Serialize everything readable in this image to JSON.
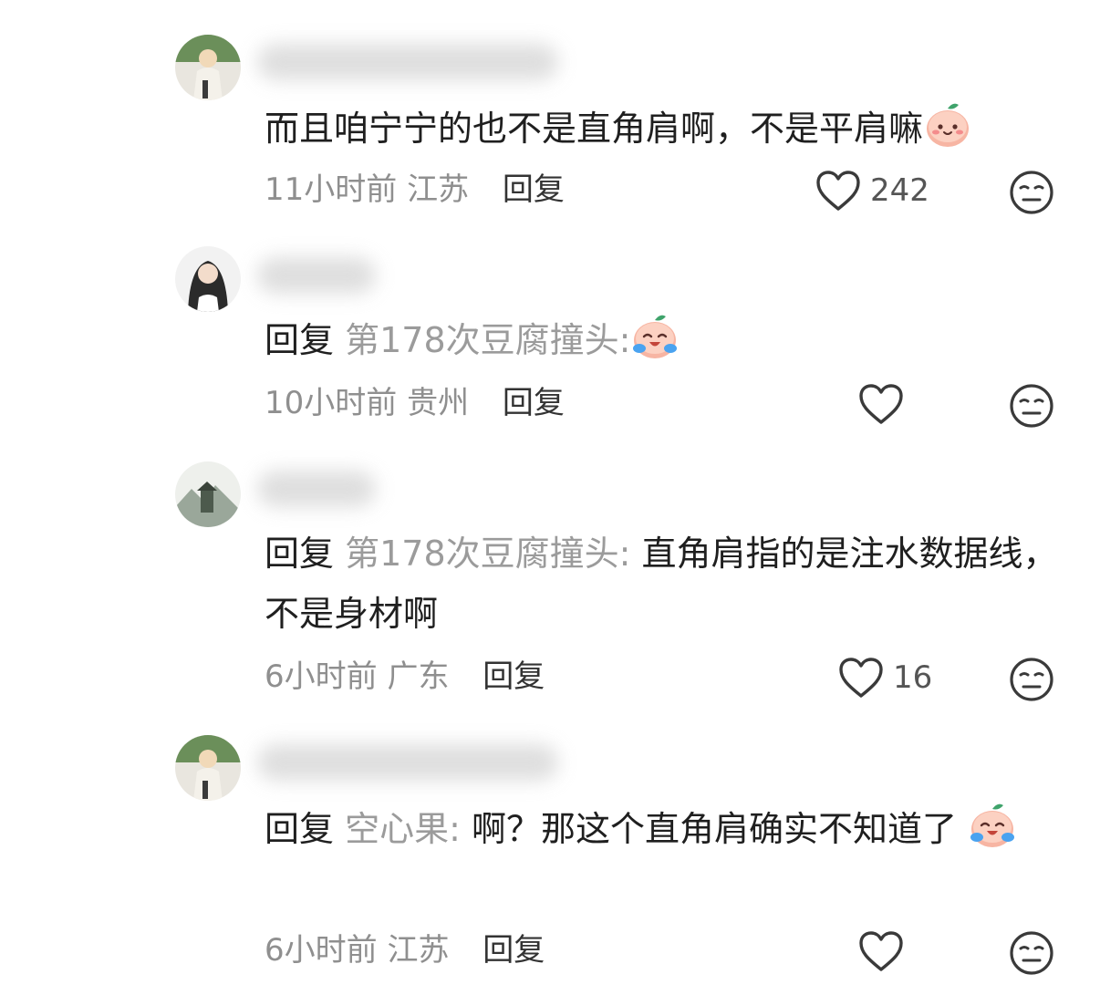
{
  "comments": [
    {
      "text": "而且咱宁宁的也不是直角肩啊，不是平肩嘛",
      "emoji_icon": "smiling-peach-emoji",
      "time": "11小时前",
      "location": "江苏",
      "reply_label": "回复",
      "likes": "242"
    },
    {
      "reply_prefix": "回复",
      "reply_target": "第178次豆腐撞头:",
      "text": "",
      "emoji_icon": "laughing-crying-peach-emoji",
      "time": "10小时前",
      "location": "贵州",
      "reply_label": "回复",
      "likes": ""
    },
    {
      "reply_prefix": "回复",
      "reply_target": "第178次豆腐撞头:",
      "text": "直角肩指的是注水数据线，不是身材啊",
      "time": "6小时前",
      "location": "广东",
      "reply_label": "回复",
      "likes": "16"
    },
    {
      "reply_prefix": "回复",
      "reply_target": "空心果:",
      "text": "啊？那这个直角肩确实不知道了",
      "emoji_icon": "laughing-crying-peach-emoji",
      "time": "6小时前",
      "location": "江苏",
      "reply_label": "回复",
      "likes": ""
    }
  ],
  "icons": {
    "like": "heart-outline-icon",
    "dislike": "meh-face-icon"
  },
  "colors": {
    "text": "#1f1f1f",
    "meta": "#8f8f8f",
    "reply_target": "#9b9b9b",
    "icon": "#3a3a3a"
  }
}
